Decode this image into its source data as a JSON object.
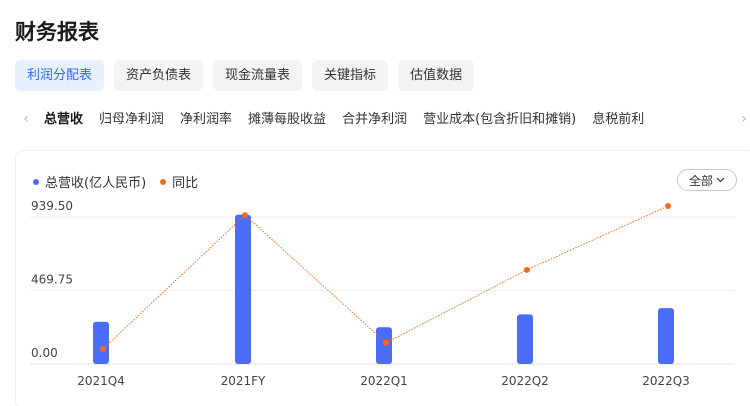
{
  "page": {
    "title": "财务报表"
  },
  "category_tabs": [
    {
      "label": "利润分配表",
      "active": true
    },
    {
      "label": "资产负债表",
      "active": false
    },
    {
      "label": "现金流量表",
      "active": false
    },
    {
      "label": "关键指标",
      "active": false
    },
    {
      "label": "估值数据",
      "active": false
    }
  ],
  "sub_tabs": [
    {
      "label": "总营收",
      "active": true
    },
    {
      "label": "归母净利润",
      "active": false
    },
    {
      "label": "净利润率",
      "active": false
    },
    {
      "label": "摊薄每股收益",
      "active": false
    },
    {
      "label": "合并净利润",
      "active": false
    },
    {
      "label": "营业成本(包含折旧和摊销)",
      "active": false
    },
    {
      "label": "息税前利",
      "active": false
    }
  ],
  "nav": {
    "prev_icon": "‹",
    "next_icon": "›"
  },
  "filter": {
    "label": "全部",
    "icon": "chevron-down-icon"
  },
  "colors": {
    "bar": "#4a6cf7",
    "line": "#f26b21",
    "accent": "#2f6bff"
  },
  "chart_data": {
    "type": "bar",
    "categories": [
      "2021Q4",
      "2021FY",
      "2022Q1",
      "2022Q2",
      "2022Q3"
    ],
    "y_ticks": [
      "939.50",
      "469.75",
      "0.00"
    ],
    "ylim": [
      0,
      939.5
    ],
    "series": [
      {
        "name": "总营收(亿人民币)",
        "type": "bar",
        "values": [
          270,
          955,
          235,
          317,
          357
        ]
      },
      {
        "name": "同比",
        "type": "line",
        "relative_levels": [
          0.06,
          0.94,
          0.1,
          0.58,
          1.0
        ]
      }
    ],
    "grid": true,
    "legend_position": "top-left"
  }
}
